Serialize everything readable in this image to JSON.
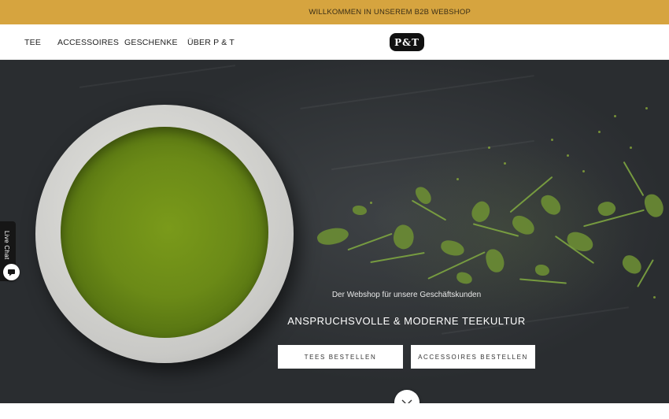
{
  "topbar": {
    "text": "WILLKOMMEN IN UNSEREM B2B WEBSHOP"
  },
  "nav": {
    "items": [
      {
        "label": "TEE"
      },
      {
        "label": "ACCESSOIRES"
      },
      {
        "label": "GESCHENKE"
      },
      {
        "label": "ÜBER P & T"
      }
    ],
    "logo_text": "P&T"
  },
  "hero": {
    "subtitle": "Der Webshop für unsere Geschäftskunden",
    "title": "ANSPRUCHSVOLLE & MODERNE TEEKULTUR",
    "buttons": [
      {
        "label": "TEES BESTELLEN"
      },
      {
        "label": "ACCESSOIRES BESTELLEN"
      }
    ],
    "scroll_icon": "chevron-down-icon"
  },
  "livechat": {
    "label": "Live Chat",
    "icon": "chat-bubble-icon"
  },
  "colors": {
    "accent": "#d6a43f",
    "dark": "#161616",
    "tea_green": "#6b8a17"
  }
}
